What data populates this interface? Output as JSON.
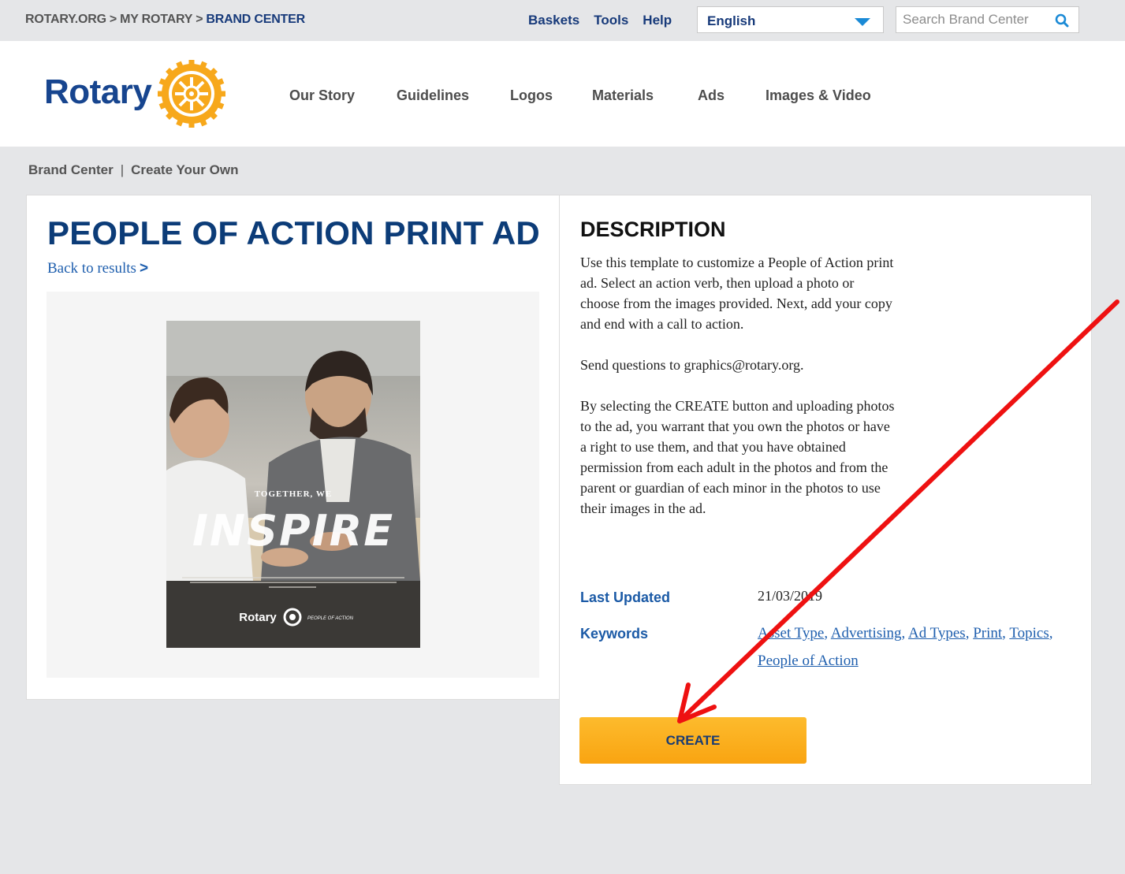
{
  "breadcrumb_top": {
    "items": [
      "ROTARY.ORG",
      "MY ROTARY",
      "BRAND CENTER"
    ],
    "separator": ">"
  },
  "top_links": {
    "baskets": "Baskets",
    "tools": "Tools",
    "help": "Help"
  },
  "language": {
    "selected": "English"
  },
  "search": {
    "placeholder": "Search Brand Center"
  },
  "logo": {
    "text": "Rotary"
  },
  "nav": [
    "Our Story",
    "Guidelines",
    "Logos",
    "Materials",
    "Ads",
    "Images & Video"
  ],
  "page_breadcrumb": {
    "items": [
      "Brand Center",
      "Create Your Own"
    ],
    "separator": "|"
  },
  "asset": {
    "title": "PEOPLE OF ACTION PRINT AD",
    "back_link": "Back to results",
    "back_chevron": ">",
    "preview": {
      "small_text": "TOGETHER, WE",
      "big_text": "INSPIRE",
      "brand": "Rotary",
      "tagline": "PEOPLE OF ACTION"
    }
  },
  "description": {
    "heading": "DESCRIPTION",
    "paragraphs": [
      "Use this template to customize a People of Action print ad. Select an action verb, then upload a photo or choose from the images provided. Next, add your copy and end with a call to action.",
      "Send questions to graphics@rotary.org.",
      "By selecting the CREATE button and uploading photos to the ad, you warrant that you own the photos or have a right to use them, and that you have obtained permission from each adult in the photos and from the parent or guardian of each minor in the photos to use their images in the ad."
    ],
    "last_updated_label": "Last Updated",
    "last_updated_value": "21/03/2019",
    "keywords_label": "Keywords",
    "keywords": [
      "Asset Type",
      "Advertising",
      "Ad Types",
      "Print",
      "Topics",
      "People of Action"
    ],
    "create_button": "CREATE"
  },
  "colors": {
    "navy": "#17458f",
    "link_blue": "#1f5fae",
    "gold": "#f7a81b",
    "annotation_red": "#ee1111"
  }
}
